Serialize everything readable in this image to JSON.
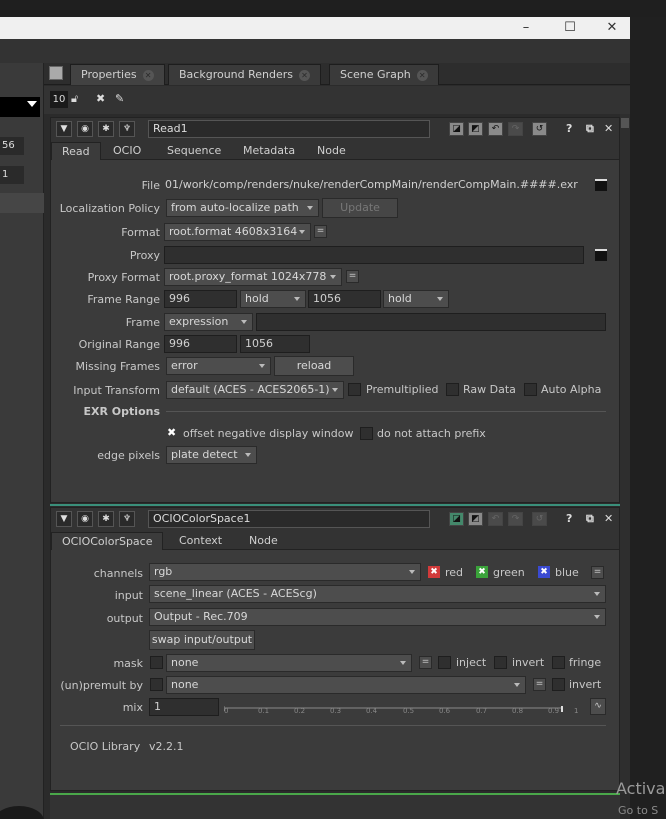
{
  "window": {
    "minimize": "–",
    "maximize": "☐",
    "close": "✕"
  },
  "left_panel": {
    "values": [
      "56",
      "1"
    ]
  },
  "panel_tabs": [
    {
      "label": "Properties"
    },
    {
      "label": "Background Renders"
    },
    {
      "label": "Scene Graph"
    }
  ],
  "toolbar": {
    "max_panels": "10"
  },
  "read": {
    "name": "Read1",
    "tabs": [
      "Read",
      "OCIO",
      "Sequence",
      "Metadata",
      "Node"
    ],
    "file_label": "File",
    "file_value": "01/work/comp/renders/nuke/renderCompMain/renderCompMain.####.exr",
    "localization_label": "Localization Policy",
    "localization_value": "from auto-localize path",
    "update_button": "Update",
    "format_label": "Format",
    "format_value": "root.format 4608x3164",
    "proxy_label": "Proxy",
    "proxy_format_label": "Proxy Format",
    "proxy_format_value": "root.proxy_format 1024x778",
    "frame_range_label": "Frame Range",
    "frame_range_start": "996",
    "frame_range_before": "hold",
    "frame_range_end": "1056",
    "frame_range_after": "hold",
    "frame_label": "Frame",
    "frame_mode": "expression",
    "original_range_label": "Original Range",
    "original_start": "996",
    "original_end": "1056",
    "missing_frames_label": "Missing Frames",
    "missing_frames_value": "error",
    "reload_button": "reload",
    "input_transform_label": "Input Transform",
    "input_transform_value": "default (ACES - ACES2065-1)",
    "premultiplied": "Premultiplied",
    "raw_data": "Raw Data",
    "auto_alpha": "Auto Alpha",
    "exr_options": "EXR Options",
    "offset_negative": "offset negative display window",
    "do_not_attach": "do not attach prefix",
    "edge_pixels_label": "edge pixels",
    "edge_pixels_value": "plate detect"
  },
  "ocio": {
    "name": "OCIOColorSpace1",
    "tabs": [
      "OCIOColorSpace",
      "Context",
      "Node"
    ],
    "channels_label": "channels",
    "channels_value": "rgb",
    "red": "red",
    "green": "green",
    "blue": "blue",
    "input_label": "input",
    "input_value": "scene_linear (ACES - ACEScg)",
    "output_label": "output",
    "output_value": "Output - Rec.709",
    "swap_button": "swap input/output",
    "mask_label": "mask",
    "mask_value": "none",
    "inject": "inject",
    "invert": "invert",
    "fringe": "fringe",
    "unpremult_label": "(un)premult by",
    "unpremult_value": "none",
    "invert2": "invert",
    "mix_label": "mix",
    "mix_value": "1",
    "ticks": [
      "0",
      "0.1",
      "0.2",
      "0.3",
      "0.4",
      "0.5",
      "0.6",
      "0.7",
      "0.8",
      "0.9",
      "1"
    ],
    "library_label": "OCIO Library",
    "library_value": "v2.2.1"
  },
  "watermark": {
    "line1": "Activa",
    "line2": "Go to S"
  }
}
